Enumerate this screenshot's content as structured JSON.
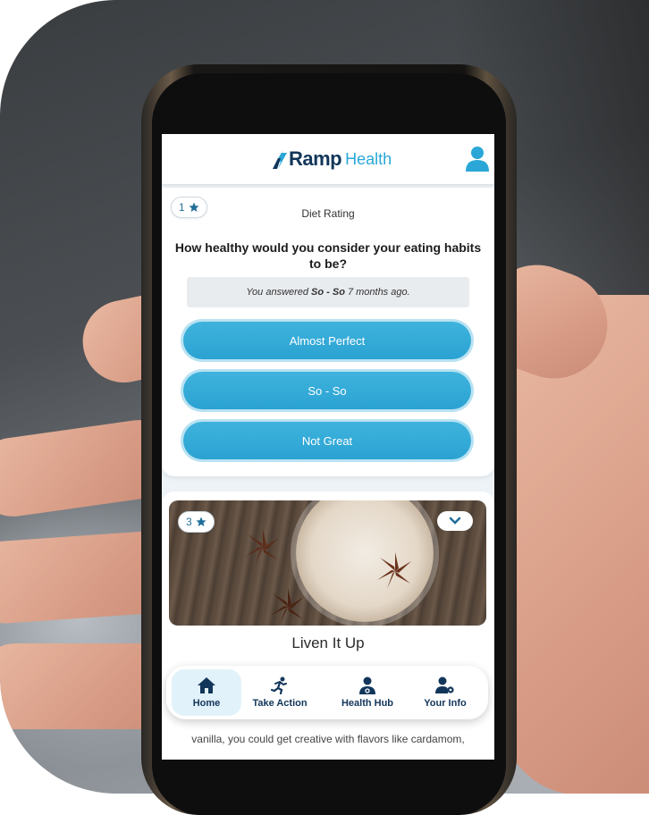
{
  "header": {
    "brand_primary": "Ramp",
    "brand_secondary": "Health",
    "brand_dark": "#12365a",
    "brand_accent": "#2aa7d6",
    "profile_icon": "user-icon"
  },
  "question_card": {
    "points": "1",
    "category": "Diet Rating",
    "question": "How healthy would you consider your eating habits to be?",
    "answered_prefix": "You answered",
    "answered_value": "So - So",
    "answered_suffix": "7 months ago.",
    "choices": [
      "Almost Perfect",
      "So - So",
      "Not Great"
    ],
    "button_color": "#2aa2d2"
  },
  "content_card": {
    "points": "3",
    "title": "Liven It Up",
    "body_visible": "vanilla, you could get creative with flavors like cardamom,"
  },
  "bottom_nav": {
    "items": [
      {
        "label": "Home",
        "icon": "home-icon",
        "active": true
      },
      {
        "label": "Take Action",
        "icon": "running-icon",
        "active": false
      },
      {
        "label": "Health Hub",
        "icon": "doctor-icon",
        "active": false
      },
      {
        "label": "Your Info",
        "icon": "user-settings-icon",
        "active": false
      }
    ]
  }
}
